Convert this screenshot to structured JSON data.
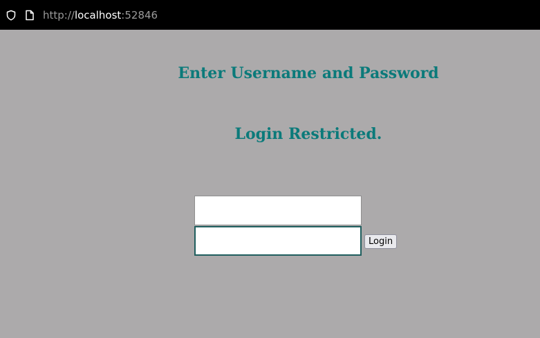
{
  "browser": {
    "url_scheme": "http://",
    "url_host": "localhost",
    "url_port": ":52846"
  },
  "page": {
    "heading_primary": "Enter Username and Password",
    "heading_secondary": "Login Restricted.",
    "background_color": "#acaaab",
    "heading_color": "#0b7a7a"
  },
  "form": {
    "username_value": "",
    "password_value": "",
    "login_label": "Login"
  }
}
